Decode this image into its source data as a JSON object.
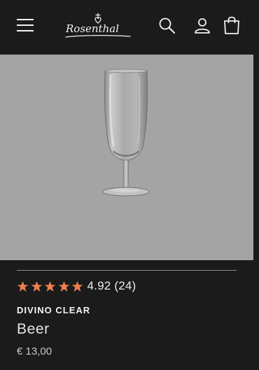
{
  "header": {
    "logo_text": "Rosenthal",
    "icons": [
      "menu-icon",
      "search-icon",
      "account-icon",
      "cart-icon"
    ]
  },
  "product": {
    "image_alt": "beer glass",
    "rating": {
      "stars": 5,
      "filled": 5,
      "value": "4.92",
      "count": "(24)"
    },
    "brand": "DIVINO CLEAR",
    "name": "Beer",
    "price": "€ 13,00"
  },
  "colors": {
    "background": "#1b1b1b",
    "hero_background": "#a4a4a4",
    "star": "#ef7f4f",
    "divider": "#8a8a8a"
  }
}
